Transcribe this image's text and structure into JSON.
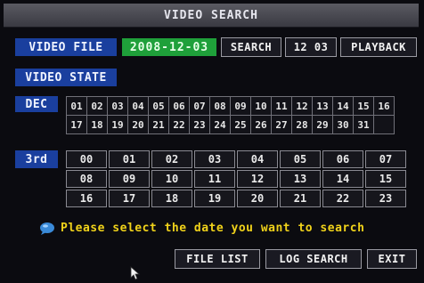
{
  "title": "VIDEO SEARCH",
  "video_file": {
    "label": "VIDEO FILE",
    "date": "2008-12-03",
    "search_button": "SEARCH",
    "time_button": "12 03",
    "playback_button": "PLAYBACK"
  },
  "video_state_label": "VIDEO STATE",
  "calendar": {
    "month_label": "DEC",
    "days": [
      "01",
      "02",
      "03",
      "04",
      "05",
      "06",
      "07",
      "08",
      "09",
      "10",
      "11",
      "12",
      "13",
      "14",
      "15",
      "16",
      "17",
      "18",
      "19",
      "20",
      "21",
      "22",
      "23",
      "24",
      "25",
      "26",
      "27",
      "28",
      "29",
      "30",
      "31"
    ]
  },
  "hours": {
    "period_label": "3rd",
    "values": [
      "00",
      "01",
      "02",
      "03",
      "04",
      "05",
      "06",
      "07",
      "08",
      "09",
      "10",
      "11",
      "12",
      "13",
      "14",
      "15",
      "16",
      "17",
      "18",
      "19",
      "20",
      "21",
      "22",
      "23"
    ]
  },
  "prompt": "Please select the date you want to search",
  "bottom_buttons": {
    "file_list": "FILE LIST",
    "log_search": "LOG SEARCH",
    "exit": "EXIT"
  },
  "colors": {
    "label_blue": "#1a3f9e",
    "date_green": "#1fa03a",
    "prompt_yellow": "#f0d21a"
  },
  "icons": {
    "info": "info-bubble-icon",
    "cursor": "mouse-pointer-icon"
  }
}
